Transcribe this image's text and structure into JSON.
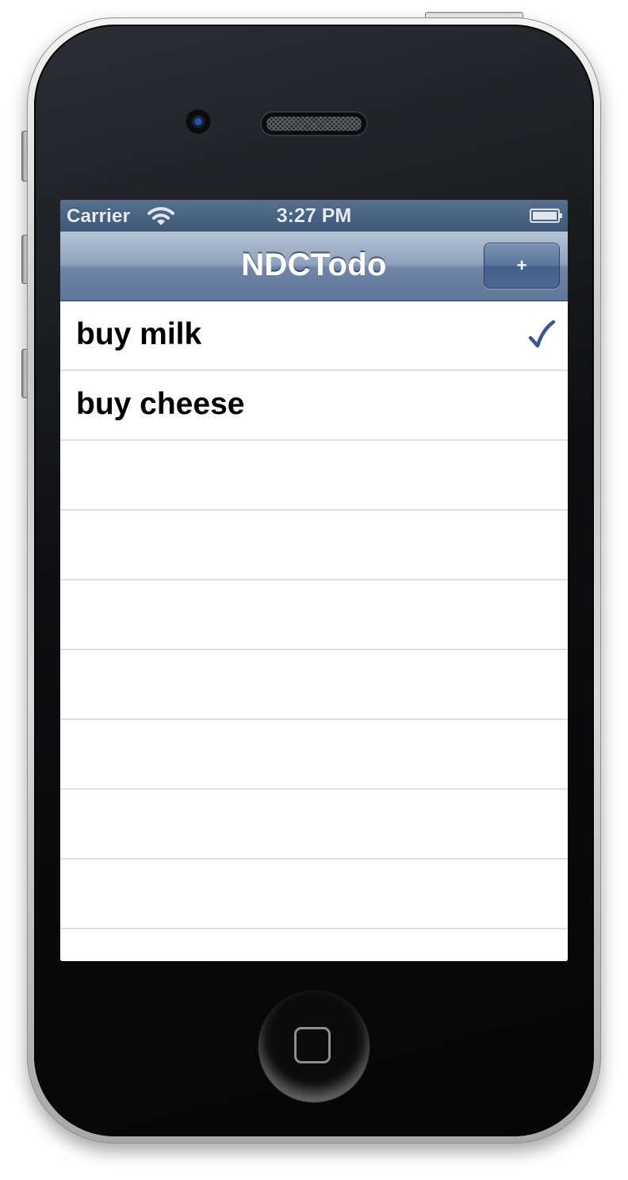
{
  "status_bar": {
    "carrier": "Carrier",
    "time": "3:27 PM",
    "wifi_icon": "wifi-icon",
    "battery_icon": "battery-icon"
  },
  "nav_bar": {
    "title": "NDCTodo",
    "add_button_label": "+"
  },
  "todos": [
    {
      "label": "buy milk",
      "checked": true
    },
    {
      "label": "buy cheese",
      "checked": false
    }
  ],
  "colors": {
    "nav_bar": "#6f86a6",
    "checkmark": "#3b5688",
    "status_bar": "#4a6382"
  }
}
